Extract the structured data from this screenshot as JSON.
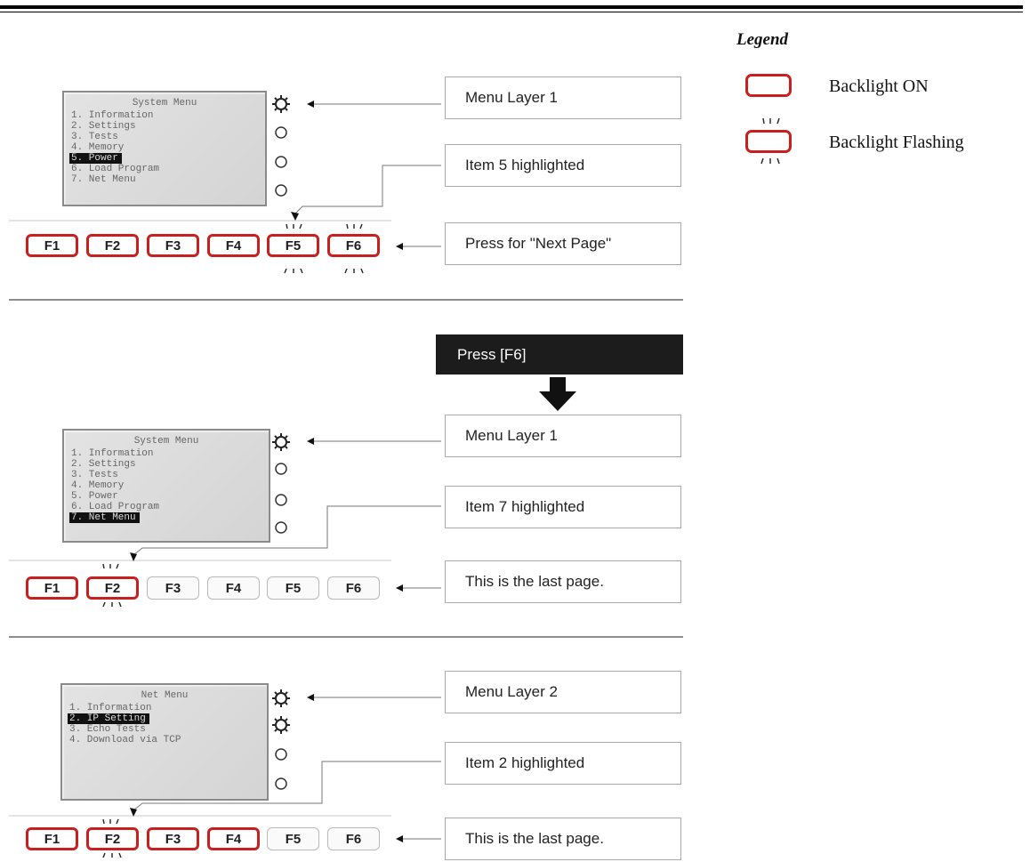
{
  "legend": {
    "title": "Legend",
    "items": [
      {
        "label": "Backlight ON"
      },
      {
        "label": "Backlight Flashing"
      }
    ]
  },
  "panels": [
    {
      "lcd": {
        "title": "System Menu",
        "lines": [
          "1. Information",
          "2. Settings",
          "3. Tests",
          "4. Memory",
          "5. Power",
          "6. Load Program",
          "7. Net Menu"
        ],
        "highlighted_index": 4
      },
      "keys": [
        "F1",
        "F2",
        "F3",
        "F4",
        "F5",
        "F6"
      ],
      "callouts": [
        "Menu Layer 1",
        "Item 5 highlighted",
        "Press for \"Next Page\""
      ]
    },
    {
      "lcd": {
        "title": "System Menu",
        "lines": [
          "1. Information",
          "2. Settings",
          "3. Tests",
          "4. Memory",
          "5. Power",
          "6. Load Program",
          "7. Net Menu"
        ],
        "highlighted_index": 6
      },
      "keys": [
        "F1",
        "F2",
        "F3",
        "F4",
        "F5",
        "F6"
      ],
      "callouts": [
        "Menu Layer 1",
        "Item 7 highlighted",
        "This is the last page."
      ]
    },
    {
      "lcd": {
        "title": "Net Menu",
        "lines": [
          "1. Information",
          "2. IP Setting",
          "3. Echo Tests",
          "4. Download via TCP"
        ],
        "highlighted_index": 1
      },
      "keys": [
        "F1",
        "F2",
        "F3",
        "F4",
        "F5",
        "F6"
      ],
      "callouts": [
        "Menu Layer 2",
        "Item 2 highlighted",
        "This is the last page."
      ]
    }
  ],
  "transition": {
    "label": "Press [F6]"
  }
}
